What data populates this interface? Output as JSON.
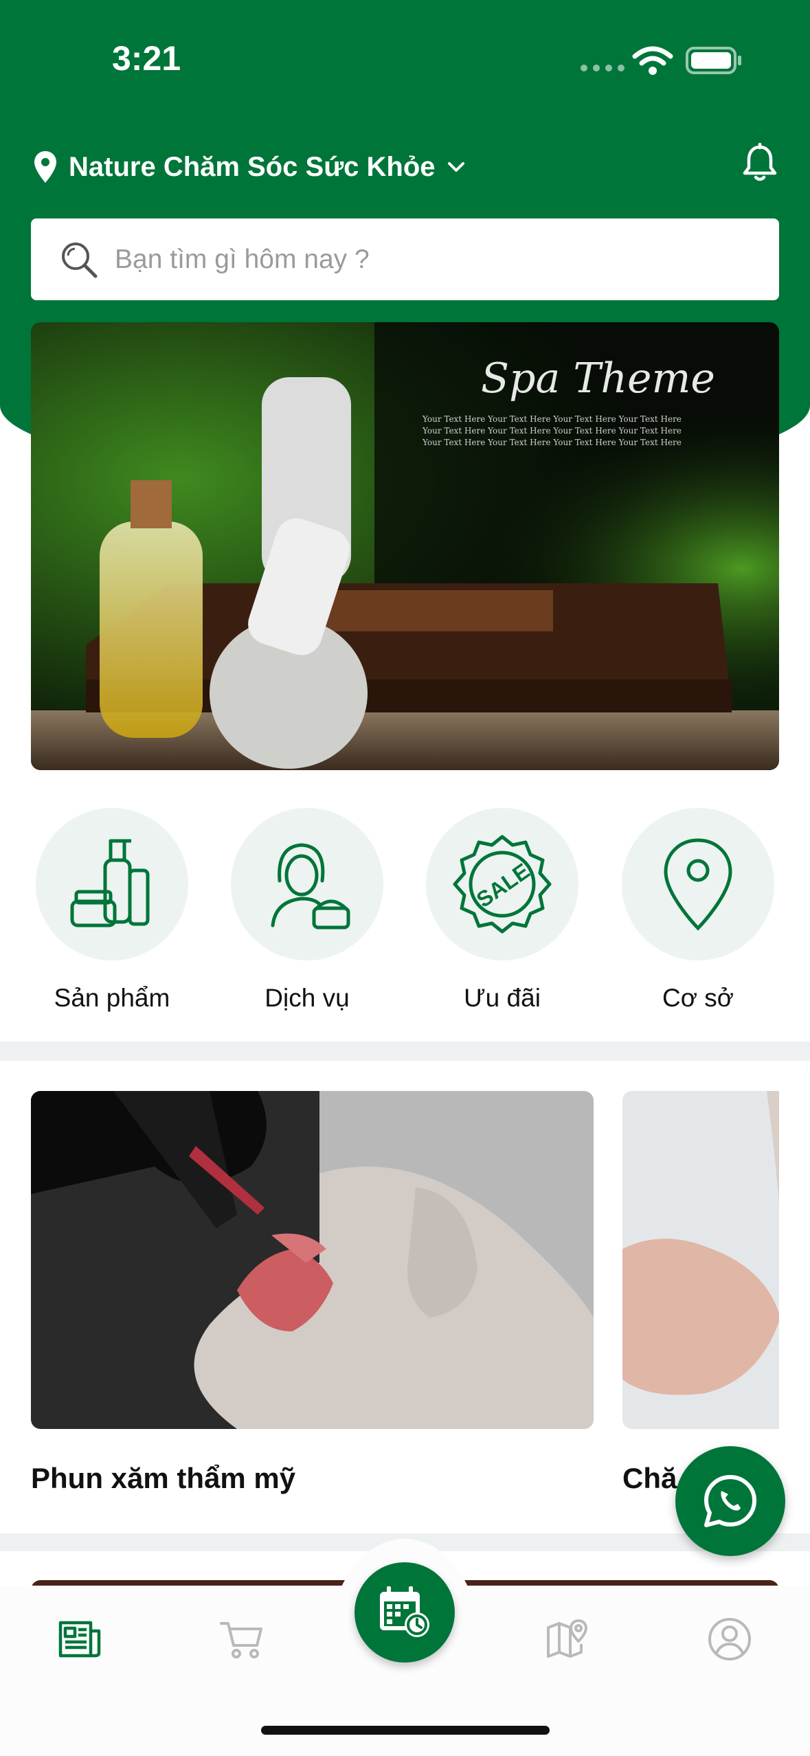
{
  "status_bar": {
    "time": "3:21"
  },
  "header": {
    "location": "Nature Chăm Sóc Sức Khỏe"
  },
  "search": {
    "placeholder": "Bạn tìm gì hôm nay ?"
  },
  "banner": {
    "title": "Spa Theme",
    "body_lines": [
      "Your Text Here  Your Text Here    Your Text Here  Your Text Here",
      "Your Text Here  Your Text Here    Your Text Here  Your Text Here",
      "Your Text Here  Your Text Here    Your Text Here  Your Text Here"
    ]
  },
  "categories": [
    {
      "label": "Sản phẩm",
      "icon": "cosmetics-icon"
    },
    {
      "label": "Dịch vụ",
      "icon": "woman-cream-icon"
    },
    {
      "label": "Ưu đãi",
      "icon": "sale-badge-icon"
    },
    {
      "label": "Cơ sở",
      "icon": "map-pin-icon"
    }
  ],
  "services": [
    {
      "title": "Phun xăm thẩm mỹ"
    },
    {
      "title": "Chă"
    }
  ],
  "sale_badge_text": "SALE",
  "colors": {
    "primary": "#00753a",
    "tile_bg": "#edf3f0",
    "divider": "#eef1f2",
    "inactive_icon": "#b9b9b9"
  },
  "tabbar": [
    "news-icon",
    "cart-icon",
    "calendar-clock-icon",
    "map-icon",
    "profile-icon"
  ]
}
